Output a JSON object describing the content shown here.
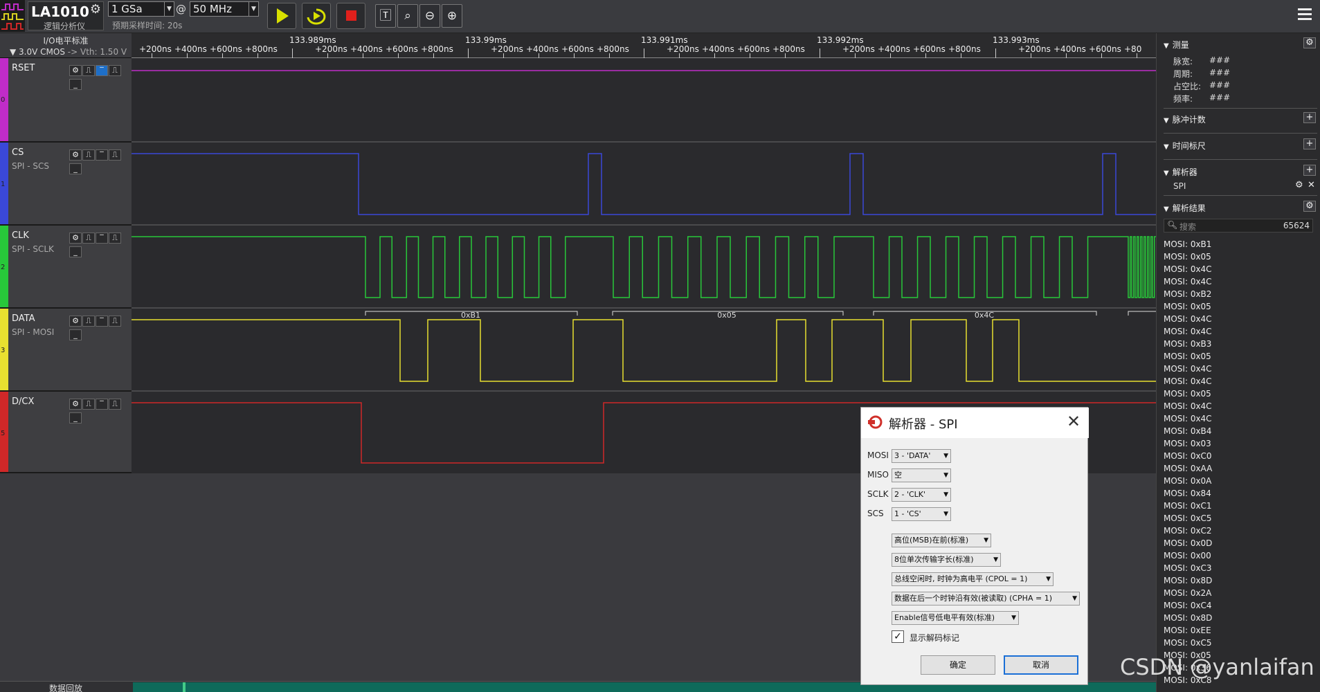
{
  "toolbar": {
    "app_name": "LA1010",
    "app_subtitle": "逻辑分析仪",
    "sample_rate": "1 GSa",
    "at": "@",
    "frequency": "50 MHz",
    "expected_time": "预期采样时间: 20s",
    "start_icon": "play-icon",
    "loop_icon": "loop-play-icon",
    "stop_icon": "stop-icon",
    "stop_color": "#e0201c",
    "play_color": "#d8e000"
  },
  "channel_header": {
    "title": "I/O电平标准",
    "voltage": "▼ 3.0V CMOS",
    "vth": "-> Vth: 1.50 V"
  },
  "ruler": {
    "major": [
      "133.989ms",
      "133.99ms",
      "133.991ms",
      "133.992ms",
      "133.993ms"
    ],
    "minor": [
      "+200ns",
      "+400ns",
      "+600ns",
      "+800ns"
    ],
    "partial": "+80"
  },
  "channels": [
    {
      "index": "0",
      "name": "RSET",
      "sub": "",
      "color": "#c02cc8"
    },
    {
      "index": "1",
      "name": "CS",
      "sub": "SPI - SCS",
      "color": "#3a48d8"
    },
    {
      "index": "2",
      "name": "CLK",
      "sub": "SPI - SCLK",
      "color": "#28c83a"
    },
    {
      "index": "3",
      "name": "DATA",
      "sub": "SPI - MOSI",
      "color": "#e8e030"
    },
    {
      "index": "5",
      "name": "D/CX",
      "sub": "",
      "color": "#d02828"
    }
  ],
  "decode_labels": [
    "0xB1",
    "0x05",
    "0x4C"
  ],
  "status": {
    "label": "数据回放"
  },
  "panel": {
    "measure": {
      "title": "测量",
      "rows": [
        {
          "k": "脉宽:",
          "v": "###"
        },
        {
          "k": "周期:",
          "v": "###"
        },
        {
          "k": "占空比:",
          "v": "###"
        },
        {
          "k": "频率:",
          "v": "###"
        }
      ]
    },
    "pulse_count": "脉冲计数",
    "time_ruler": "时间标尺",
    "decoder": "解析器",
    "decoder_item": "SPI",
    "results_title": "解析结果",
    "search_placeholder": "搜索",
    "result_count": "65624",
    "results": [
      "MOSI: 0xB1",
      "MOSI: 0x05",
      "MOSI: 0x4C",
      "MOSI: 0x4C",
      "MOSI: 0xB2",
      "MOSI: 0x05",
      "MOSI: 0x4C",
      "MOSI: 0x4C",
      "MOSI: 0xB3",
      "MOSI: 0x05",
      "MOSI: 0x4C",
      "MOSI: 0x4C",
      "MOSI: 0x05",
      "MOSI: 0x4C",
      "MOSI: 0x4C",
      "MOSI: 0xB4",
      "MOSI: 0x03",
      "MOSI: 0xC0",
      "MOSI: 0xAA",
      "MOSI: 0x0A",
      "MOSI: 0x84",
      "MOSI: 0xC1",
      "MOSI: 0xC5",
      "MOSI: 0xC2",
      "MOSI: 0x0D",
      "MOSI: 0x00",
      "MOSI: 0xC3",
      "MOSI: 0x8D",
      "MOSI: 0x2A",
      "MOSI: 0xC4",
      "MOSI: 0x8D",
      "MOSI: 0xEE",
      "MOSI: 0xC5",
      "MOSI: 0x05",
      "MOSI: 0x36",
      "MOSI: 0xC8"
    ]
  },
  "dialog": {
    "title": "解析器 - SPI",
    "mosi_label": "MOSI",
    "mosi_value": "3 - 'DATA'",
    "miso_label": "MISO",
    "miso_value": "空",
    "sclk_label": "SCLK",
    "sclk_value": "2 - 'CLK'",
    "scs_label": "SCS",
    "scs_value": "1 - 'CS'",
    "bit_order": "高位(MSB)在前(标准)",
    "word_len": "8位单次传输字长(标准)",
    "cpol": "总线空闲时, 时钟为高电平 (CPOL = 1)",
    "cpha": "数据在后一个时钟沿有效(被读取) (CPHA = 1)",
    "enable": "Enable信号低电平有效(标准)",
    "show_marks": "显示解码标记",
    "ok": "确定",
    "cancel": "取消"
  },
  "watermark": "CSDN @yanlaifan"
}
